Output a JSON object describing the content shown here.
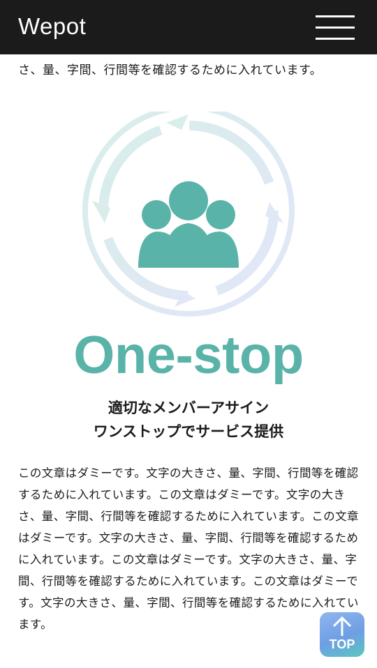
{
  "header": {
    "logo_text": "Wepot",
    "menu_label": "menu"
  },
  "intro_line": "さ、量、字間、行間等を確認するために入れています。",
  "illustration": {
    "icon": "people-group-icon",
    "ring": "circular-arrows-icon",
    "accent_color": "#5ab3a8"
  },
  "onestop_label": "One-stop",
  "headline": {
    "line1": "適切なメンバーアサイン",
    "line2": "ワンストップでサービス提供"
  },
  "body_paragraph": "この文章はダミーです。文字の大きさ、量、字間、行間等を確認するために入れています。この文章はダミーです。文字の大きさ、量、字間、行間等を確認するために入れています。この文章はダミーです。文字の大きさ、量、字間、行間等を確認するために入れています。この文章はダミーです。文字の大きさ、量、字間、行間等を確認するために入れています。この文章はダミーです。文字の大きさ、量、字間、行間等を確認するために入れています。",
  "top_button": {
    "label": "TOP",
    "icon": "arrow-up-icon"
  }
}
